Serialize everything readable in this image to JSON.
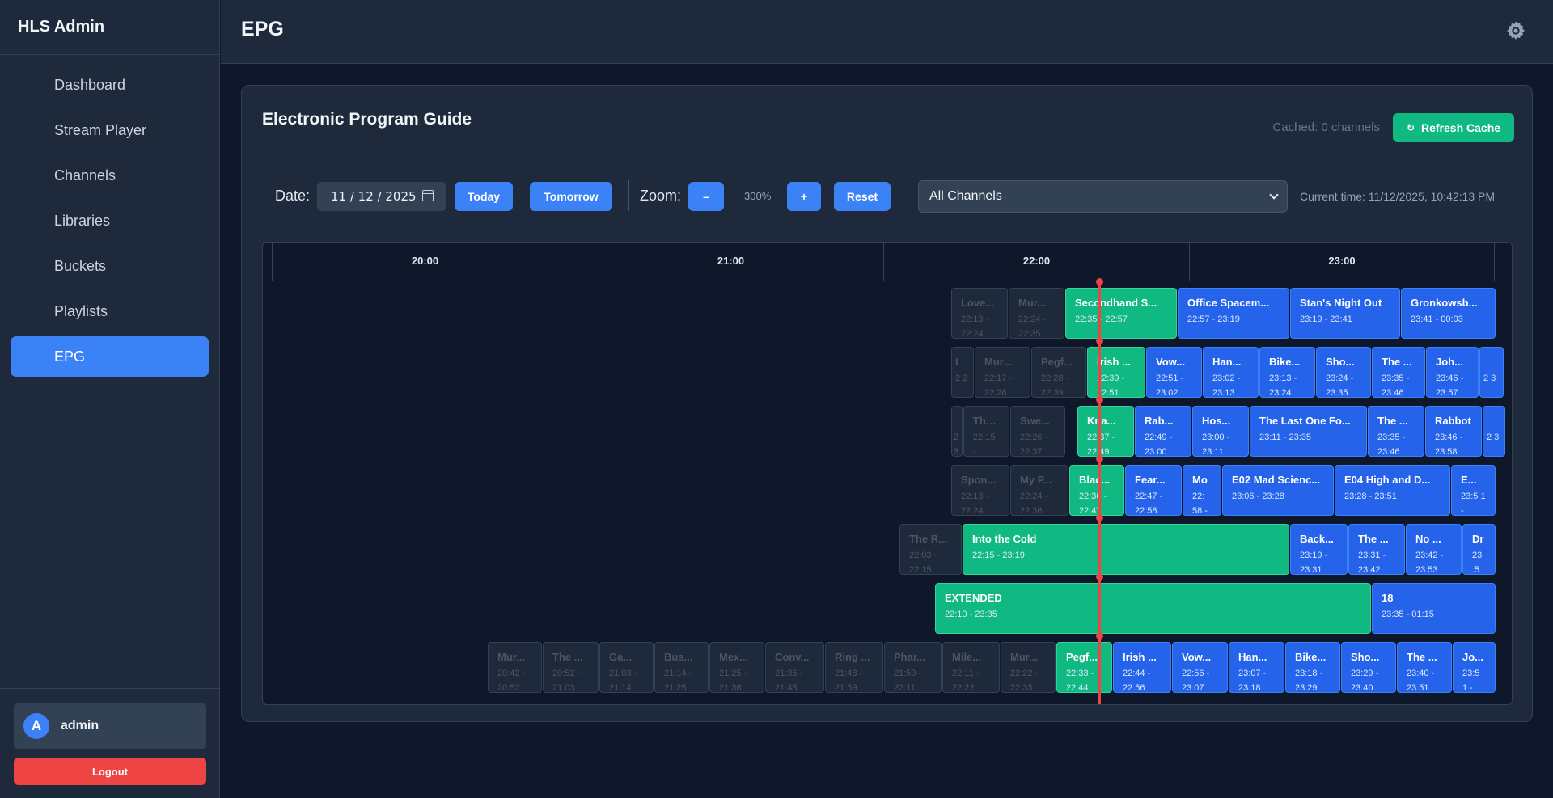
{
  "sidebar": {
    "brand": "HLS Admin",
    "items": [
      {
        "label": "Dashboard",
        "name": "sidebar-item-dashboard"
      },
      {
        "label": "Stream Player",
        "name": "sidebar-item-stream-player"
      },
      {
        "label": "Channels",
        "name": "sidebar-item-channels"
      },
      {
        "label": "Libraries",
        "name": "sidebar-item-libraries"
      },
      {
        "label": "Buckets",
        "name": "sidebar-item-buckets"
      },
      {
        "label": "Playlists",
        "name": "sidebar-item-playlists"
      },
      {
        "label": "EPG",
        "name": "sidebar-item-epg",
        "active": true
      }
    ],
    "user": {
      "initial": "A",
      "name": "admin"
    },
    "logout_label": "Logout"
  },
  "header": {
    "title": "EPG",
    "settings_icon": "gear-icon"
  },
  "card": {
    "title": "Electronic Program Guide",
    "cached_text": "Cached: 0 channels",
    "refresh_label": "Refresh Cache"
  },
  "controls": {
    "date_label": "Date:",
    "date_value": "11 / 12 / 2025",
    "today_label": "Today",
    "tomorrow_label": "Tomorrow",
    "zoom_label": "Zoom:",
    "zoom_out_label": "–",
    "zoom_value": "300%",
    "zoom_in_label": "+",
    "reset_label": "Reset",
    "channel_select": "All Channels",
    "current_time": "Current time: 11/12/2025, 10:42:13 PM"
  },
  "timeline": {
    "hours": [
      "20:00",
      "21:00",
      "22:00",
      "23:00"
    ]
  },
  "colors": {
    "accent": "#3b82f6",
    "now": "#10b981",
    "danger": "#ef4444",
    "bg": "#0f172a",
    "panel": "#1e293b"
  }
}
